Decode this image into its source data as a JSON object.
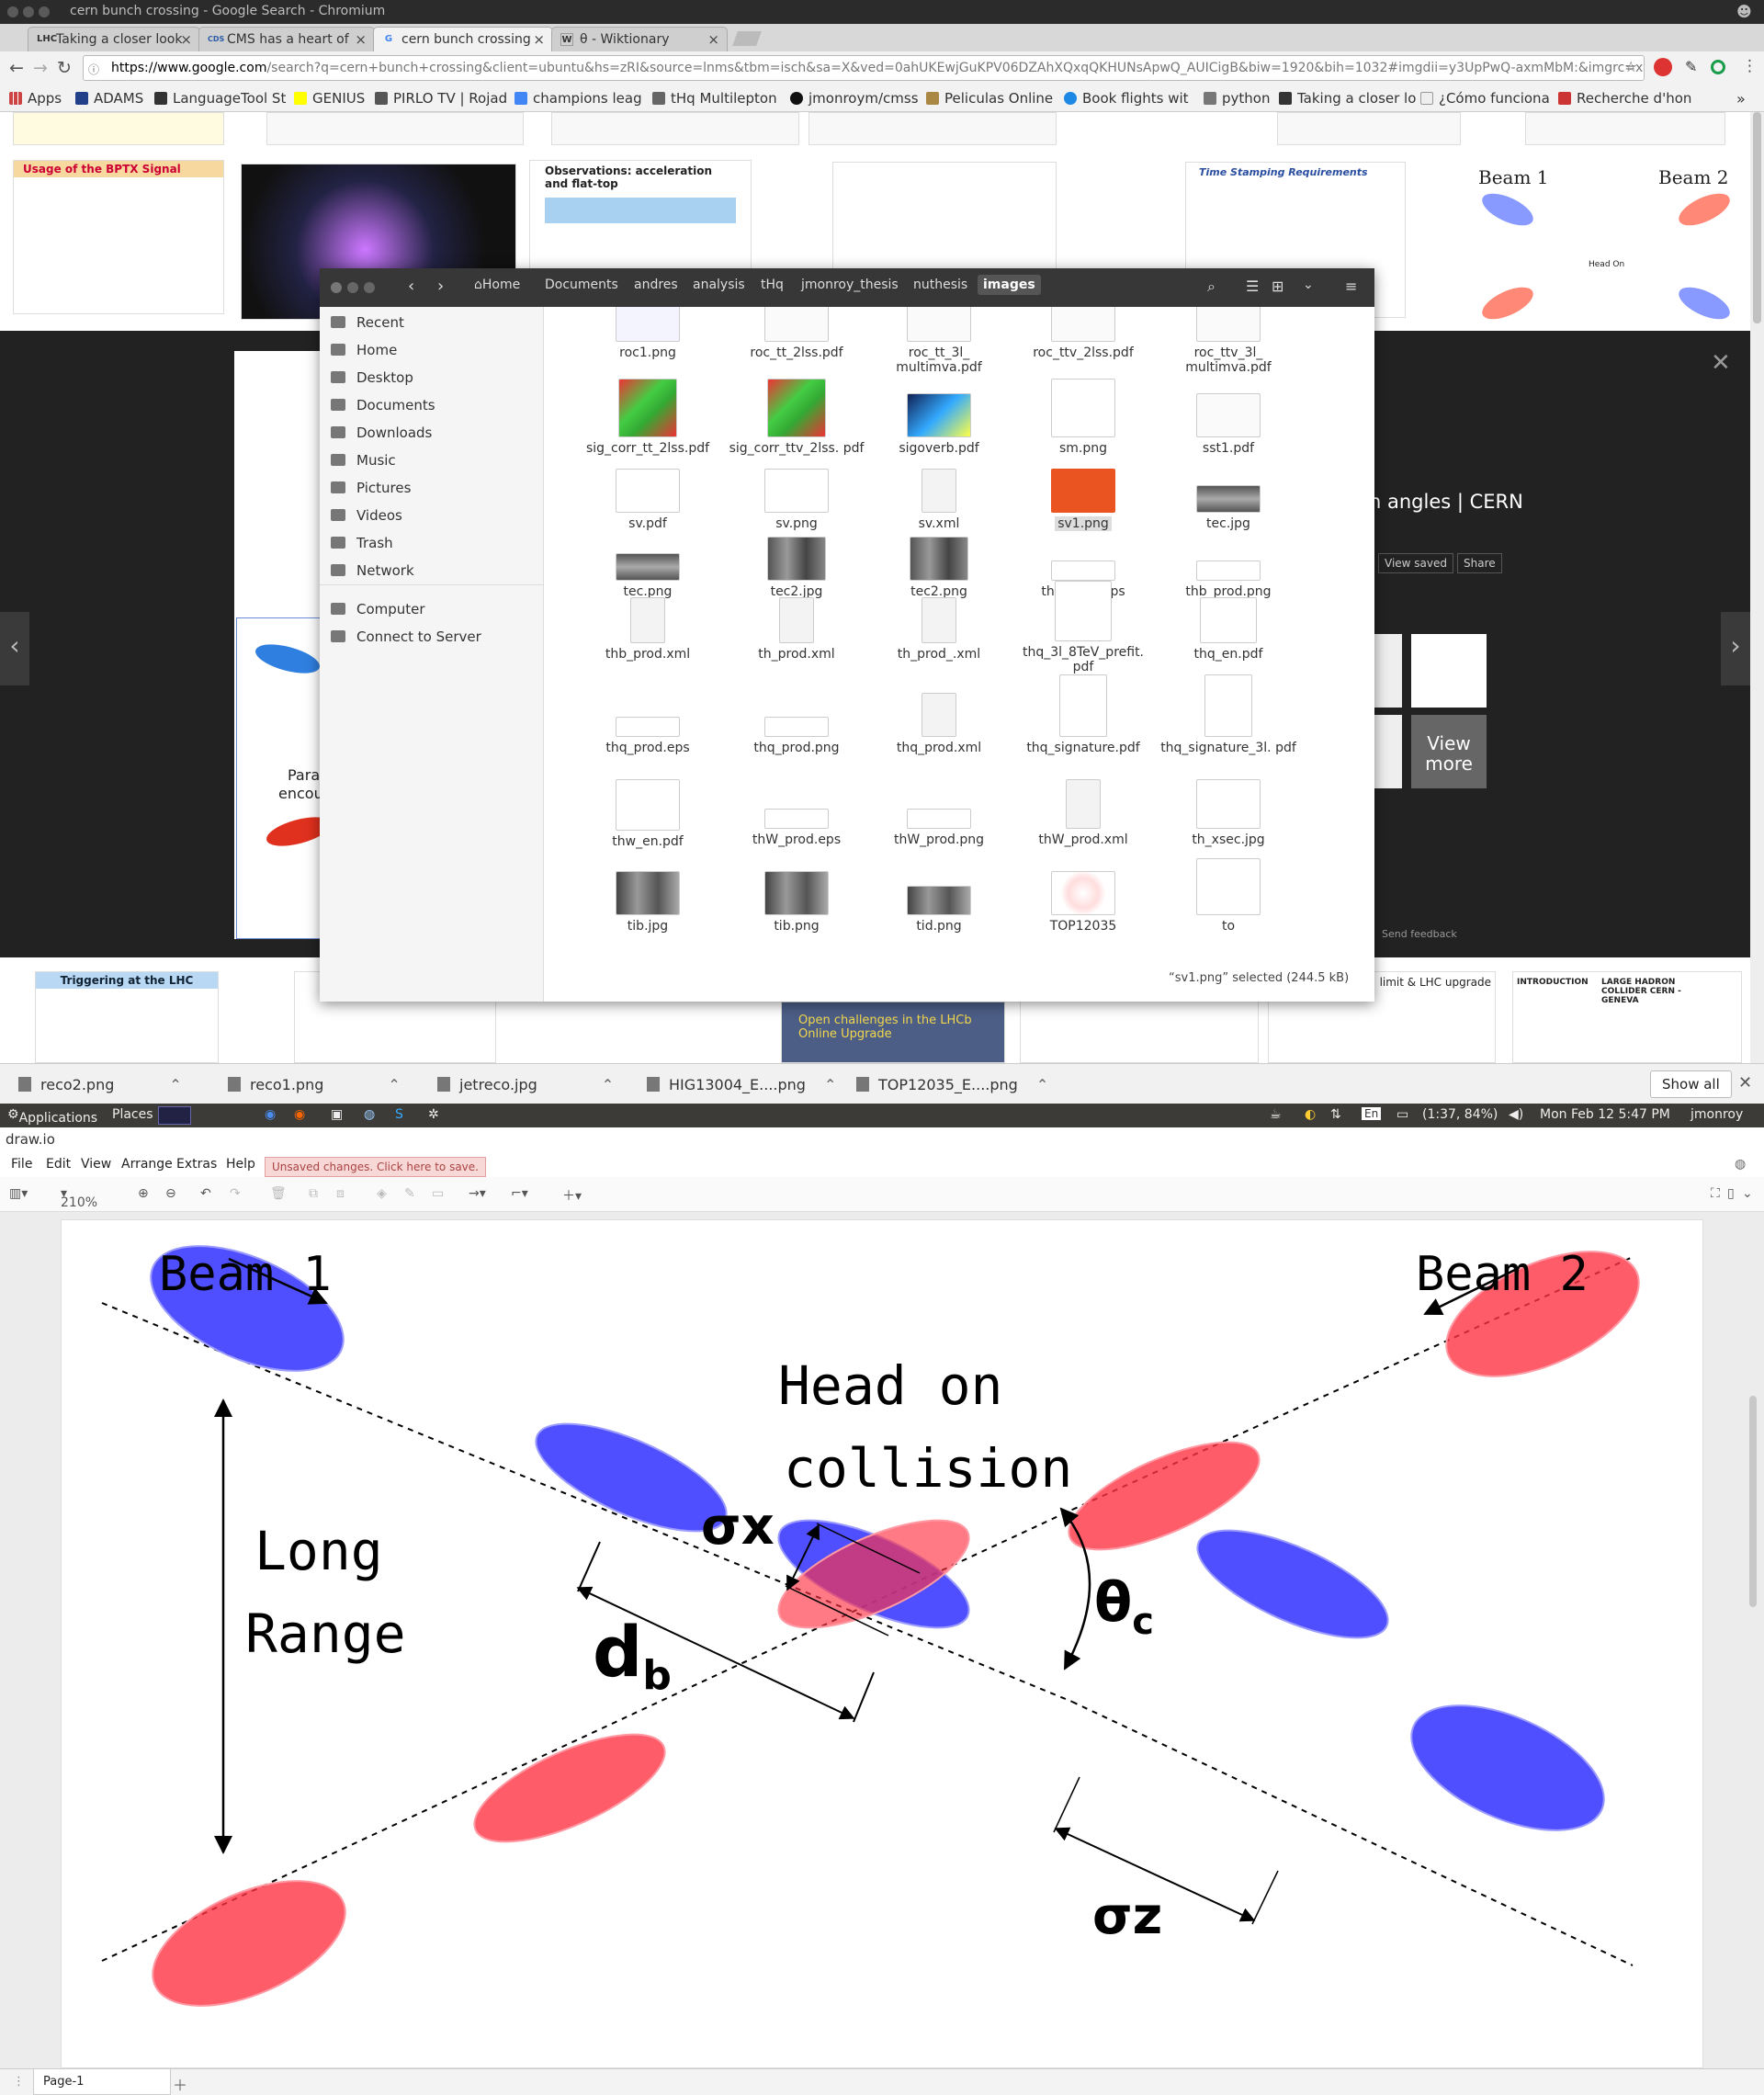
{
  "browser": {
    "window_title": "cern bunch crossing - Google Search - Chromium",
    "tabs": [
      {
        "label": "Taking a closer look",
        "icon": "LHC"
      },
      {
        "label": "CMS has a heart of",
        "icon": "CDS"
      },
      {
        "label": "cern bunch crossing",
        "icon": "G",
        "active": true
      },
      {
        "label": "θ - Wiktionary",
        "icon": "W"
      }
    ],
    "url_host": "https://www.google.com",
    "url_rest": "/search?q=cern+bunch+crossing&client=ubuntu&hs=zRI&source=lnms&tbm=isch&sa=X&ved=0ahUKEwjGuKPV06DZAhXQxqQKHUNsApwQ_AUICigB&biw=1920&bih=1032#imgdii=y3UpPwQ-axmMbM:&imgrc=xD6zVzW7dlk3WM:",
    "bookmarks": [
      "Apps",
      "ADAMS",
      "LanguageTool St",
      "GENIUS",
      "PIRLO TV | Rojad",
      "champions leag",
      "tHq Multilepton",
      "jmonroym/cmss",
      "Peliculas Online",
      "Book flights wit",
      "python",
      "Taking a closer lo",
      "¿Cómo funciona",
      "Recherche d'hon"
    ]
  },
  "google_images": {
    "overlay_title": "n angles | CERN",
    "view_saved": "View saved",
    "share": "Share",
    "view_more": "View more",
    "send_feedback": "Send feedback",
    "left_panel_text": [
      "Para",
      "encou"
    ],
    "thumb_texts": {
      "bptx": "Usage of the BPTX Signal",
      "obs": "Observations: acceleration and flat-top",
      "stamping": "Time Stamping Requirements",
      "beam1": "Beam 1",
      "beam2": "Beam 2",
      "headon": "Head On",
      "trig": "Triggering at the LHC",
      "lhcb": "Open challenges in the LHCb Online Upgrade",
      "upgrade": "limit & LHC upgrade",
      "lhc_collider": "LARGE HADRON COLLIDER CERN - GENEVA",
      "intro": "INTRODUCTION"
    }
  },
  "files": {
    "path": [
      "Home",
      "Documents",
      "andres",
      "analysis",
      "tHq",
      "jmonroy_thesis",
      "nuthesis",
      "images"
    ],
    "sidebar": [
      "Recent",
      "Home",
      "Desktop",
      "Documents",
      "Downloads",
      "Music",
      "Pictures",
      "Videos",
      "Trash",
      "Network",
      "Computer",
      "Connect to Server"
    ],
    "items": [
      [
        "roc1.png",
        "roc_tt_2lss.pdf",
        "roc_tt_3l_ multimva.pdf",
        "roc_ttv_2lss.pdf",
        "roc_ttv_3l_ multimva.pdf"
      ],
      [
        "sig_corr_tt_2lss.pdf",
        "sig_corr_ttv_2lss. pdf",
        "sigoverb.pdf",
        "sm.png",
        "sst1.pdf"
      ],
      [
        "sv.pdf",
        "sv.png",
        "sv.xml",
        "sv1.png",
        "tec.jpg"
      ],
      [
        "tec.png",
        "tec2.jpg",
        "tec2.png",
        "thb_prod.eps",
        "thb_prod.png"
      ],
      [
        "thb_prod.xml",
        "th_prod.xml",
        "th_prod_.xml",
        "thq_3l_8TeV_prefit. pdf",
        "thq_en.pdf"
      ],
      [
        "thq_prod.eps",
        "thq_prod.png",
        "thq_prod.xml",
        "thq_signature.pdf",
        "thq_signature_3l. pdf"
      ],
      [
        "thw_en.pdf",
        "thW_prod.eps",
        "thW_prod.png",
        "thW_prod.xml",
        "th_xsec.jpg"
      ],
      [
        "tib.jpg",
        "tib.png",
        "tid.png",
        "TOP12035",
        "to"
      ]
    ],
    "selected": "sv1.png",
    "status": "“sv1.png” selected (244.5 kB)"
  },
  "downloads": [
    "reco2.png",
    "reco1.png",
    "jetreco.jpg",
    "HIG13004_E....png",
    "TOP12035_E....png"
  ],
  "downloads_show_all": "Show all",
  "panel": {
    "applications": "Applications",
    "places": "Places",
    "lang": "En",
    "battery": "(1:37, 84%)",
    "datetime": "Mon Feb 12  5:47 PM",
    "user": "jmonroy"
  },
  "drawio": {
    "title": "draw.io",
    "menu": [
      "File",
      "Edit",
      "View",
      "Arrange",
      "Extras",
      "Help"
    ],
    "unsaved": "Unsaved changes. Click here to save.",
    "zoom": "210%",
    "page_tab": "Page-1"
  },
  "diagram": {
    "beam1": "Beam 1",
    "beam2": "Beam 2",
    "head_on": "Head on",
    "collision": "collision",
    "long": "Long",
    "range": "Range",
    "sigma_x": "σx",
    "sigma_z": "σz",
    "d_b": "d",
    "d_b_sub": "b",
    "theta_c": "θ",
    "theta_c_sub": "c",
    "colors": {
      "blue": "#3333ff",
      "red": "#ff3344"
    }
  }
}
